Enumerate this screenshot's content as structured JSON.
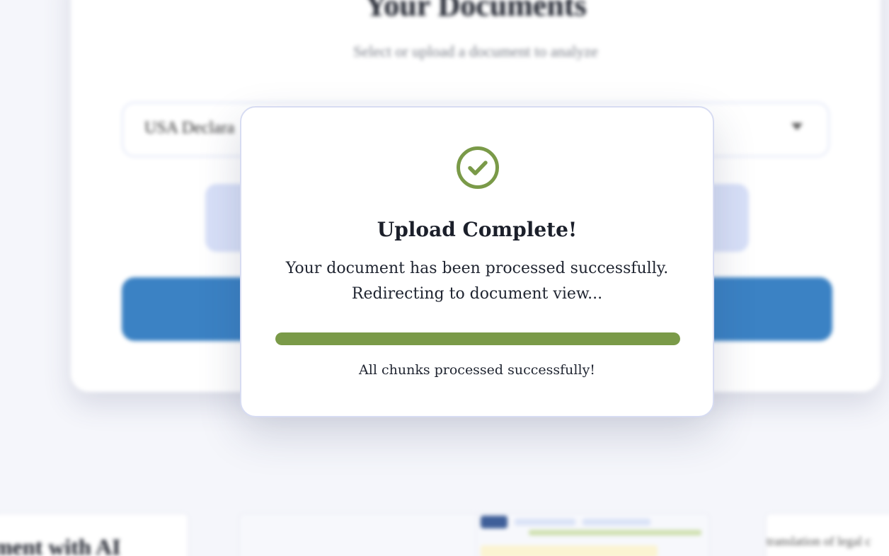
{
  "background": {
    "card_title": "Your Documents",
    "card_subtitle": "Select or upload a document to analyze",
    "document_select_value": "USA Declara",
    "feature_text_left": "ment with AI",
    "feature_text_right": "translation of legal c"
  },
  "modal": {
    "icon": "check-circle-icon",
    "title": "Upload Complete!",
    "message_line1": "Your document has been processed successfully.",
    "message_line2": "Redirecting to document view...",
    "progress": 1.0,
    "status": "All chunks processed successfully!"
  },
  "colors": {
    "accent_green": "#7a9a48",
    "primary_blue": "#3b82c4",
    "modal_border": "#d7dcf2"
  }
}
